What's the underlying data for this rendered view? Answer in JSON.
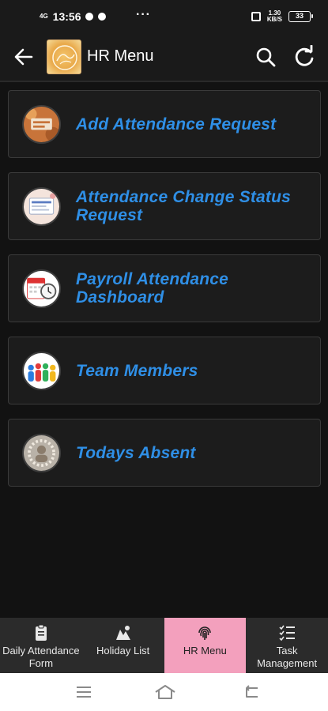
{
  "status_bar": {
    "time": "13:56",
    "signal_label": "4G",
    "network_speed_value": "1.30",
    "network_speed_unit": "KB/S",
    "battery": "33"
  },
  "app_bar": {
    "title": "HR Menu"
  },
  "menu_items": [
    {
      "label": "Add Attendance Request",
      "icon": "attendance-request-thumbnail"
    },
    {
      "label": "Attendance Change Status Request",
      "icon": "status-request-thumbnail"
    },
    {
      "label": "Payroll Attendance Dashboard",
      "icon": "payroll-calendar-thumbnail"
    },
    {
      "label": "Team Members",
      "icon": "team-members-thumbnail"
    },
    {
      "label": "Todays Absent",
      "icon": "absent-thumbnail"
    }
  ],
  "bottom_nav": [
    {
      "label": "Daily Attendance Form",
      "icon": "clipboard-icon",
      "active": false
    },
    {
      "label": "Holiday List",
      "icon": "holiday-icon",
      "active": false
    },
    {
      "label": "HR Menu",
      "icon": "fingerprint-icon",
      "active": true
    },
    {
      "label": "Task Management",
      "icon": "task-list-icon",
      "active": false
    }
  ],
  "colors": {
    "background": "#121212",
    "card": "#1c1c1c",
    "accent_text": "#2f8fe6",
    "active_tab": "#f3a0bd"
  }
}
